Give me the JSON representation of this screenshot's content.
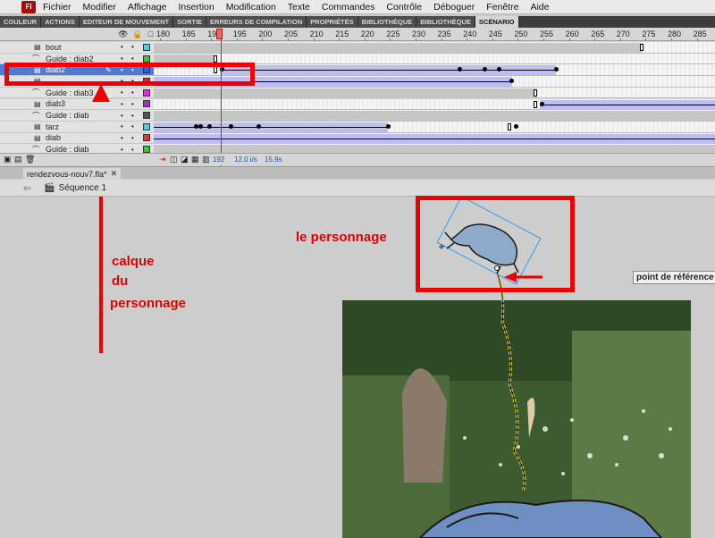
{
  "app": {
    "logo": "Fl"
  },
  "menu": [
    "Fichier",
    "Modifier",
    "Affichage",
    "Insertion",
    "Modification",
    "Texte",
    "Commandes",
    "Contrôle",
    "Déboguer",
    "Fenêtre",
    "Aide"
  ],
  "panel_tabs": [
    "COULEUR",
    "ACTIONS",
    "EDITEUR DE MOUVEMENT",
    "SORTIE",
    "ERREURS DE COMPILATION",
    "PROPRIÉTÉS",
    "BIBLIOTHÈQUE",
    "BIBLIOTHÈQUE",
    "SCÉNARIO"
  ],
  "active_panel_tab": "SCÉNARIO",
  "timeline": {
    "ruler": [
      "180",
      "185",
      "190",
      "195",
      "200",
      "205",
      "210",
      "215",
      "220",
      "225",
      "230",
      "235",
      "240",
      "245",
      "250",
      "255",
      "260",
      "265",
      "270",
      "275",
      "280",
      "285"
    ],
    "layers": [
      {
        "name": "bout",
        "type": "layer",
        "color": "#33dddd"
      },
      {
        "name": "Guide : diab2",
        "type": "guide",
        "color": "#33cc33"
      },
      {
        "name": "diab2",
        "type": "layer",
        "color": "#2e5fe8",
        "selected": true
      },
      {
        "name": "",
        "type": "layer",
        "color": "#ee2222"
      },
      {
        "name": "Guide : diab3",
        "type": "guide",
        "color": "#ee22ee"
      },
      {
        "name": "diab3",
        "type": "layer",
        "color": "#9933cc"
      },
      {
        "name": "Guide : diab",
        "type": "guide",
        "color": "#555555"
      },
      {
        "name": "tarz",
        "type": "layer",
        "color": "#33dddd"
      },
      {
        "name": "diab",
        "type": "layer",
        "color": "#ee3333"
      },
      {
        "name": "Guide : diab",
        "type": "guide",
        "color": "#33cc33"
      }
    ],
    "footer": {
      "current_frame": "192",
      "fps": "12.0 i/s",
      "time": "15.9s"
    }
  },
  "document": {
    "tab": "rendezvous-nouv7.fla*",
    "close": "✕",
    "scene": "Séquence 1"
  },
  "annotations": {
    "layer_label": [
      "calque",
      "du",
      "personnage"
    ],
    "character_label": "le personnage",
    "reference_tooltip": "point de référence"
  },
  "colors": {
    "annotation": "#ee0000",
    "selected_layer": "#4a7bd6",
    "tween": "#bebef3"
  }
}
